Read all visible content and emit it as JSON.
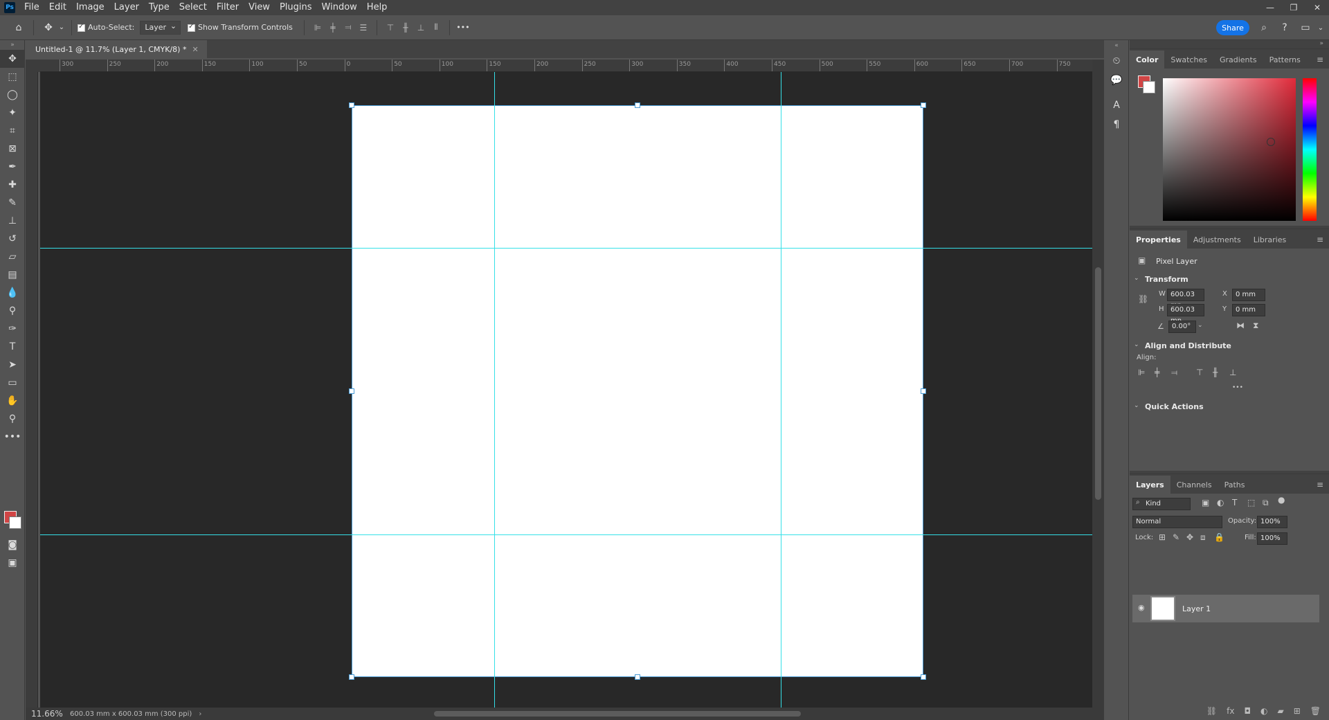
{
  "app": {
    "logo": "Ps"
  },
  "menu": [
    "File",
    "Edit",
    "Image",
    "Layer",
    "Type",
    "Select",
    "Filter",
    "View",
    "Plugins",
    "Window",
    "Help"
  ],
  "options": {
    "auto_select_label": "Auto-Select:",
    "auto_select_target": "Layer",
    "show_transform_label": "Show Transform Controls",
    "more": "•••",
    "share_label": "Share"
  },
  "document": {
    "tab_title": "Untitled-1 @ 11.7% (Layer 1, CMYK/8) *",
    "zoom": "11.66%",
    "info": "600.03 mm x 600.03 mm (300 ppi)"
  },
  "ruler_top_labels": [
    "300",
    "250",
    "200",
    "150",
    "100",
    "50",
    "0",
    "50",
    "100",
    "150",
    "200",
    "250",
    "300",
    "350",
    "400",
    "450",
    "500",
    "550",
    "600",
    "650",
    "700",
    "750"
  ],
  "color_panel": {
    "tabs": [
      "Color",
      "Swatches",
      "Gradients",
      "Patterns"
    ],
    "foreground": "#d14545",
    "background": "#ffffff"
  },
  "properties": {
    "tabs": [
      "Properties",
      "Adjustments",
      "Libraries"
    ],
    "layer_type": "Pixel Layer",
    "transform_title": "Transform",
    "w_label": "W",
    "w_value": "600.03 mn",
    "h_label": "H",
    "h_value": "600.03 mn",
    "x_label": "X",
    "x_value": "0 mm",
    "y_label": "Y",
    "y_value": "0 mm",
    "angle": "0.00°",
    "align_title": "Align and Distribute",
    "align_label": "Align:",
    "more": "•••",
    "quick_actions": "Quick Actions"
  },
  "layers": {
    "tabs": [
      "Layers",
      "Channels",
      "Paths"
    ],
    "filter_kind": "Kind",
    "blend_mode": "Normal",
    "opacity_label": "Opacity:",
    "opacity_value": "100%",
    "lock_label": "Lock:",
    "fill_label": "Fill:",
    "fill_value": "100%",
    "items": [
      {
        "name": "Layer 1"
      }
    ]
  },
  "colors": {
    "accent": "#1473e6",
    "guide": "#35e0e8",
    "selection": "#4a9cd6"
  }
}
